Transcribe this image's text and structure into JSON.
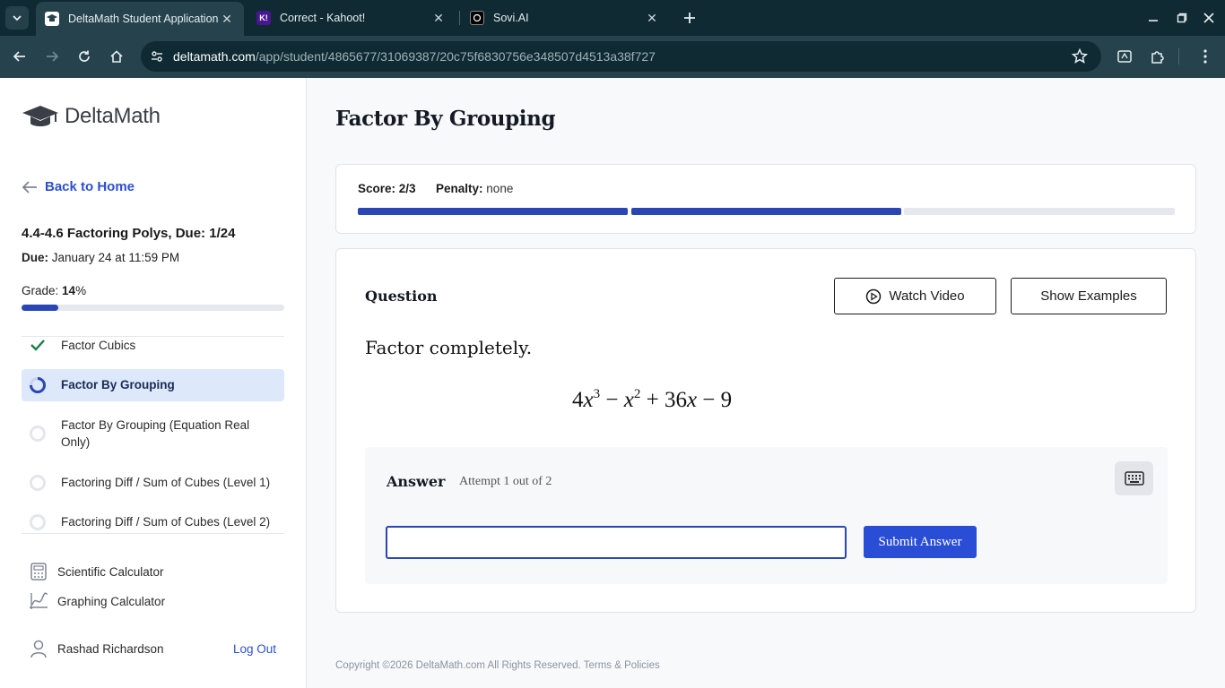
{
  "browser": {
    "tabs": [
      {
        "title": "DeltaMath Student Application",
        "active": true
      },
      {
        "title": "Correct - Kahoot!",
        "active": false,
        "favicon_text": "K!"
      },
      {
        "title": "Sovi.AI",
        "active": false
      }
    ],
    "url_host": "deltamath.com",
    "url_path": "/app/student/4865677/31069387/20c75f6830756e348507d4513a38f727"
  },
  "sidebar": {
    "logo_text": "DeltaMath",
    "back_label": "Back to Home",
    "assignment_title": "4.4-4.6 Factoring Polys, Due: 1/24",
    "due_label": "Due:",
    "due_value": "January 24 at 11:59 PM",
    "grade_label": "Grade:",
    "grade_value": "14",
    "grade_suffix": "%",
    "grade_fraction": 0.14,
    "skills": [
      {
        "label": "Factor Cubics",
        "status": "complete"
      },
      {
        "label": "Factor By Grouping",
        "status": "current"
      },
      {
        "label": "Factor By Grouping (Equation Real Only)",
        "status": "not-started"
      },
      {
        "label": "Factoring Diff / Sum of Cubes (Level 1)",
        "status": "not-started"
      },
      {
        "label": "Factoring Diff / Sum of Cubes (Level 2)",
        "status": "not-started"
      }
    ],
    "tools": [
      {
        "label": "Scientific Calculator",
        "icon": "calculator-icon"
      },
      {
        "label": "Graphing Calculator",
        "icon": "graph-icon"
      }
    ],
    "user_name": "Rashad Richardson",
    "logout_label": "Log Out"
  },
  "main": {
    "page_title": "Factor By Grouping",
    "score_label": "Score:",
    "score_value": "2/3",
    "penalty_label": "Penalty:",
    "penalty_value": "none",
    "progress_segments": [
      {
        "state": "complete"
      },
      {
        "state": "complete"
      },
      {
        "state": "incomplete"
      }
    ],
    "question_label": "Question",
    "watch_video_label": "Watch Video",
    "show_examples_label": "Show Examples",
    "prompt": "Factor completely.",
    "expression": {
      "c1": "4",
      "v1": "x",
      "e1": "3",
      "op1": "−",
      "v2": "x",
      "e2": "2",
      "op2": "+",
      "c3": "36",
      "v3": "x",
      "op3": "−",
      "c4": "9"
    },
    "answer_label": "Answer",
    "attempt_text": "Attempt 1 out of 2",
    "answer_value": "",
    "submit_label": "Submit Answer"
  },
  "footer": {
    "text": "Copyright ©2026 DeltaMath.com All Rights Reserved. Terms & Policies"
  },
  "colors": {
    "brand_blue": "#2a46b4",
    "submit_blue": "#2a4dd6",
    "link_blue": "#2c4fd0",
    "check_green": "#1a7f4b",
    "current_bg": "#dde8fb"
  }
}
